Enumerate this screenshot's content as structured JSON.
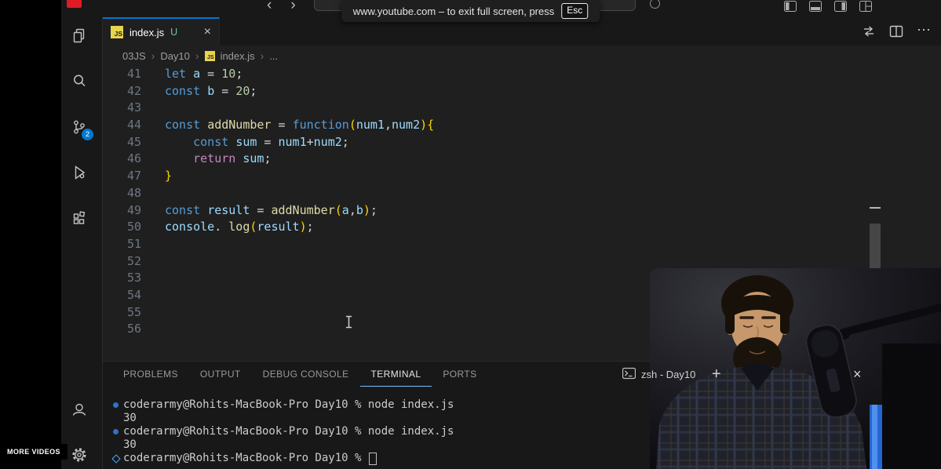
{
  "colors": {
    "accent": "#0078d4",
    "badge-bg": "#0078d4",
    "untracked-green": "#73c991",
    "panel-active": "#75beff",
    "deco-blue": "#2e72c8",
    "deco-bright": "#4daafc",
    "js-yellow": "#e8d44d",
    "tok-kw": "#569cd6",
    "tok-var": "#9cdcfe",
    "tok-num": "#b5cea8",
    "tok-func": "#dcdcaa",
    "tok-plain": "#d4d4d4",
    "tok-bracket": "#ffd700",
    "tok-ctrl": "#c586c0"
  },
  "titlebar": {
    "back_icon": "‹",
    "forward_icon": "›",
    "notification": {
      "text": "www.youtube.com – to exit full screen, press",
      "key": "Esc"
    }
  },
  "activity_bar": {
    "source_control_badge": "2"
  },
  "editor_group": {
    "tab": {
      "file": "index.js",
      "js_badge": "JS",
      "git_status": "U",
      "close_icon": "×"
    },
    "actions_more_icon": "⋯",
    "breadcrumb": {
      "folder1": "03JS",
      "folder2": "Day10",
      "file": "index.js",
      "js_badge": "JS",
      "separator": "›",
      "more": "..."
    }
  },
  "editor": {
    "lines": [
      {
        "num": "41",
        "tokens": [
          {
            "t": "let",
            "c": "kw"
          },
          {
            "t": " ",
            "c": "plain"
          },
          {
            "t": "a",
            "c": "var"
          },
          {
            "t": " = ",
            "c": "plain"
          },
          {
            "t": "10",
            "c": "num"
          },
          {
            "t": ";",
            "c": "plain"
          }
        ]
      },
      {
        "num": "42",
        "tokens": [
          {
            "t": "const",
            "c": "kw"
          },
          {
            "t": " ",
            "c": "plain"
          },
          {
            "t": "b",
            "c": "var"
          },
          {
            "t": " = ",
            "c": "plain"
          },
          {
            "t": "20",
            "c": "num"
          },
          {
            "t": ";",
            "c": "plain"
          }
        ]
      },
      {
        "num": "43",
        "tokens": []
      },
      {
        "num": "44",
        "tokens": [
          {
            "t": "const",
            "c": "kw"
          },
          {
            "t": " ",
            "c": "plain"
          },
          {
            "t": "addNumber",
            "c": "func"
          },
          {
            "t": " = ",
            "c": "plain"
          },
          {
            "t": "function",
            "c": "kw"
          },
          {
            "t": "(",
            "c": "bracket"
          },
          {
            "t": "num1",
            "c": "var"
          },
          {
            "t": ",",
            "c": "plain"
          },
          {
            "t": "num2",
            "c": "var"
          },
          {
            "t": ")",
            "c": "bracket"
          },
          {
            "t": "{",
            "c": "bracket"
          }
        ]
      },
      {
        "num": "45",
        "tokens": [
          {
            "t": "    ",
            "c": "plain"
          },
          {
            "t": "const",
            "c": "kw"
          },
          {
            "t": " ",
            "c": "plain"
          },
          {
            "t": "sum",
            "c": "var"
          },
          {
            "t": " = ",
            "c": "plain"
          },
          {
            "t": "num1",
            "c": "var"
          },
          {
            "t": "+",
            "c": "plain"
          },
          {
            "t": "num2",
            "c": "var"
          },
          {
            "t": ";",
            "c": "plain"
          }
        ]
      },
      {
        "num": "46",
        "tokens": [
          {
            "t": "    ",
            "c": "plain"
          },
          {
            "t": "return",
            "c": "ctrl"
          },
          {
            "t": " ",
            "c": "plain"
          },
          {
            "t": "sum",
            "c": "var"
          },
          {
            "t": ";",
            "c": "plain"
          }
        ]
      },
      {
        "num": "47",
        "tokens": [
          {
            "t": "}",
            "c": "bracket"
          }
        ]
      },
      {
        "num": "48",
        "tokens": []
      },
      {
        "num": "49",
        "tokens": [
          {
            "t": "const",
            "c": "kw"
          },
          {
            "t": " ",
            "c": "plain"
          },
          {
            "t": "result",
            "c": "var"
          },
          {
            "t": " = ",
            "c": "plain"
          },
          {
            "t": "addNumber",
            "c": "func"
          },
          {
            "t": "(",
            "c": "bracket"
          },
          {
            "t": "a",
            "c": "var"
          },
          {
            "t": ",",
            "c": "plain"
          },
          {
            "t": "b",
            "c": "var"
          },
          {
            "t": ")",
            "c": "bracket"
          },
          {
            "t": ";",
            "c": "plain"
          }
        ]
      },
      {
        "num": "50",
        "tokens": [
          {
            "t": "console",
            "c": "var"
          },
          {
            "t": ". ",
            "c": "plain"
          },
          {
            "t": "log",
            "c": "func"
          },
          {
            "t": "(",
            "c": "bracket"
          },
          {
            "t": "result",
            "c": "var"
          },
          {
            "t": ")",
            "c": "bracket"
          },
          {
            "t": ";",
            "c": "plain"
          }
        ]
      },
      {
        "num": "51",
        "tokens": []
      },
      {
        "num": "52",
        "tokens": []
      },
      {
        "num": "53",
        "tokens": []
      },
      {
        "num": "54",
        "tokens": []
      },
      {
        "num": "55",
        "tokens": []
      },
      {
        "num": "56",
        "tokens": []
      }
    ]
  },
  "panel": {
    "tabs": [
      {
        "label": "PROBLEMS"
      },
      {
        "label": "OUTPUT"
      },
      {
        "label": "DEBUG CONSOLE"
      },
      {
        "label": "TERMINAL",
        "active": true
      },
      {
        "label": "PORTS"
      }
    ],
    "terminal_title": "zsh - Day10",
    "new_terminal_icon": "+",
    "close_icon": "×",
    "terminal": {
      "lines": [
        {
          "deco": "dot",
          "text": "coderarmy@Rohits-MacBook-Pro Day10 % node index.js"
        },
        {
          "deco": "none",
          "text": "30"
        },
        {
          "deco": "dot",
          "text": "coderarmy@Rohits-MacBook-Pro Day10 % node index.js"
        },
        {
          "deco": "none",
          "text": "30"
        },
        {
          "deco": "diamond",
          "text": "coderarmy@Rohits-MacBook-Pro Day10 % ",
          "cursor": true
        }
      ]
    }
  },
  "overlay": {
    "more_videos": "MORE VIDEOS"
  }
}
